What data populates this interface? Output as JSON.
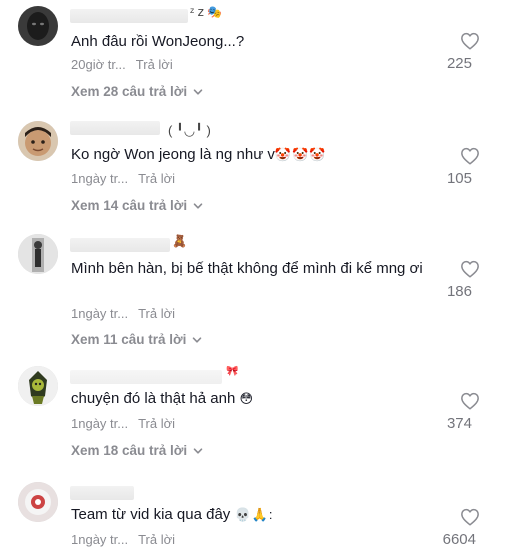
{
  "comments": [
    {
      "name_deco": "ᶻ 𝗓 🎭",
      "text": "Anh đâu rồi WonJeong...?",
      "time": "20giờ tr...",
      "reply": "Trả lời",
      "view_more": "Xem 28 câu trả lời",
      "likes": "225"
    },
    {
      "name_deco": "( ╹◡╹ )",
      "text": "Ko ngờ Won jeong là ng như v",
      "text_emoji": "🤡🤡🤡",
      "time": "1ngày tr...",
      "reply": "Trả lời",
      "view_more": "Xem 14 câu trả lời",
      "likes": "105"
    },
    {
      "name_deco": "🧸",
      "text": "Mình bên hàn, bị bế thật không để mình đi kể mng ơi",
      "time": "1ngày tr...",
      "reply": "Trả lời",
      "view_more": "Xem 11 câu trả lời",
      "likes": "186"
    },
    {
      "name_deco": "🎀",
      "text": "chuyện đó là thật hả anh",
      "text_emoji": "😳",
      "time": "1ngày tr...",
      "reply": "Trả lời",
      "view_more": "Xem 18 câu trả lời",
      "likes": "374"
    },
    {
      "name_deco": "",
      "text": "Team từ vid kia qua đây",
      "text_emoji": "💀🙏:",
      "time": "1ngày tr...",
      "reply": "Trả lời",
      "likes": "6604"
    }
  ],
  "icons": {
    "like": "heart-outline-icon",
    "expand": "chevron-down-icon"
  },
  "colors": {
    "text": "#161823",
    "muted": "#8a8b91",
    "count": "#73747b"
  }
}
